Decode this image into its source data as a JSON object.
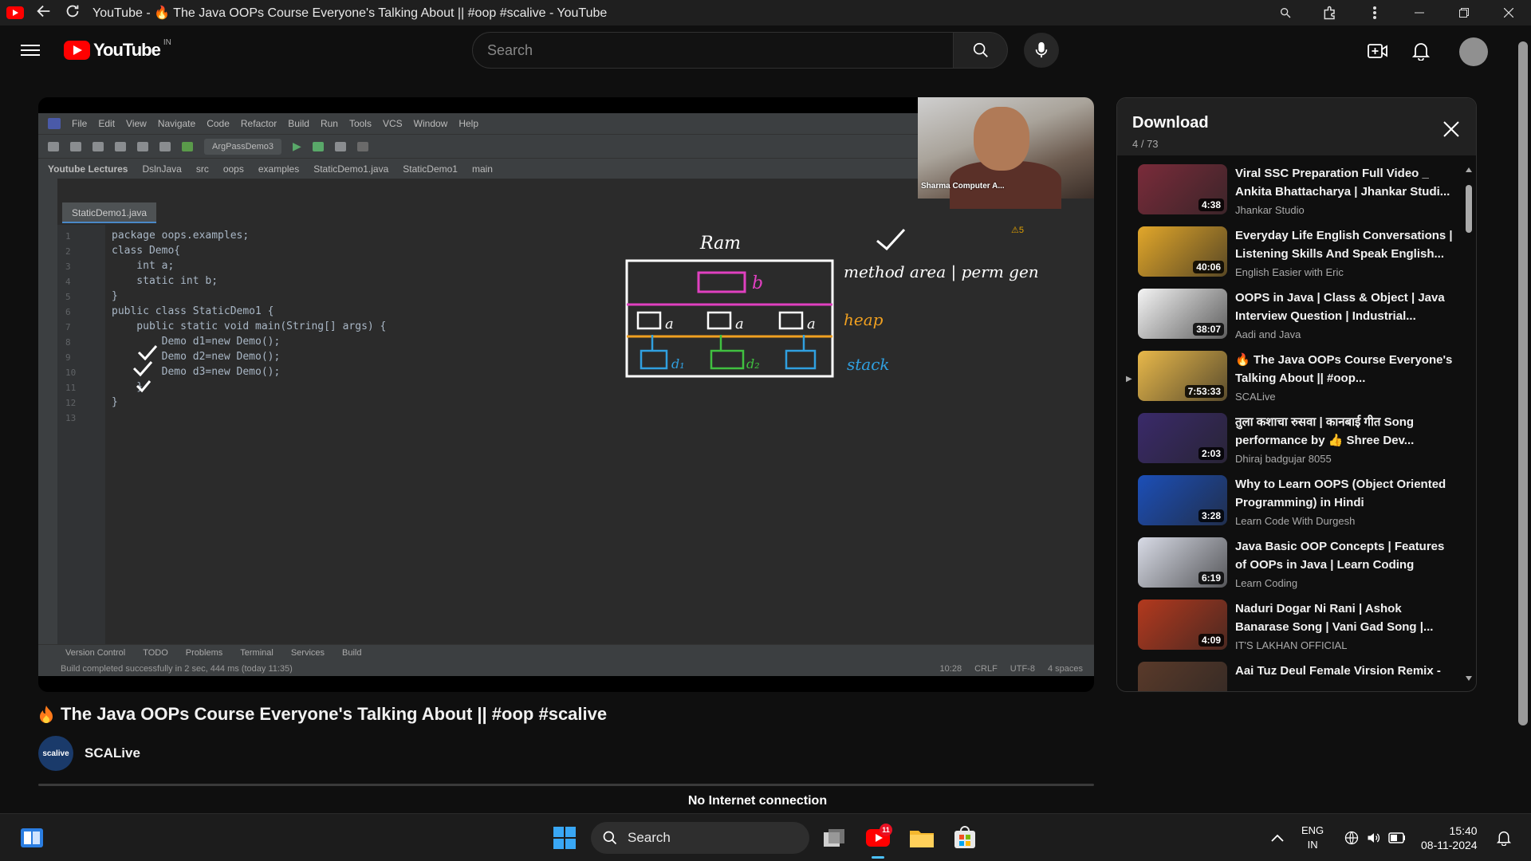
{
  "window": {
    "title": "YouTube - 🔥 The Java OOPs Course Everyone's Talking About || #oop #scalive - YouTube"
  },
  "masthead": {
    "logo_text": "YouTube",
    "region": "IN",
    "search_placeholder": "Search"
  },
  "player": {
    "webcam_label": "Sharma Computer A...",
    "ide": {
      "menu": [
        "File",
        "Edit",
        "View",
        "Navigate",
        "Code",
        "Refactor",
        "Build",
        "Run",
        "Tools",
        "VCS",
        "Window",
        "Help"
      ],
      "run_config": "ArgPassDemo3",
      "breadcrumbs": [
        "Youtube Lectures",
        "DslnJava",
        "src",
        "oops",
        "examples",
        "StaticDemo1.java",
        "StaticDemo1",
        "main"
      ],
      "file_tab": "StaticDemo1.java",
      "code_lines": [
        "package oops.examples;",
        "class Demo{",
        "    int a;",
        "    static int b;",
        "}",
        "public class StaticDemo1 {",
        "    public static void main(String[] args) {",
        "        Demo d1=new Demo();",
        "        Demo d2=new Demo();",
        "        Demo d3=new Demo();",
        "    }",
        "}",
        ""
      ],
      "bottom_tabs": [
        "Version Control",
        "TODO",
        "Problems",
        "Terminal",
        "Services",
        "Build"
      ],
      "status_message": "Build completed successfully in 2 sec, 444 ms (today 11:35)",
      "status_right": [
        "10:28",
        "CRLF",
        "UTF-8",
        "4 spaces"
      ],
      "warnings": "⚠5"
    },
    "drawing": {
      "ram": "Ram",
      "method_area": "method area | perm gen",
      "heap": "heap",
      "stack": "stack"
    }
  },
  "download_panel": {
    "title": "Download",
    "count": "4 / 73",
    "items": [
      {
        "title": "Viral SSC Preparation Full Video _ Ankita Bhattacharya | Jhankar Studi...",
        "channel": "Jhankar Studio",
        "duration": "4:38",
        "thumb_color": "#7a2b3a",
        "current": false
      },
      {
        "title": "Everyday Life English Conversations | Listening Skills And Speak English...",
        "channel": "English Easier with Eric",
        "duration": "40:06",
        "thumb_color": "#e2a72a",
        "current": false
      },
      {
        "title": "OOPS in Java | Class & Object | Java Interview Question | Industrial...",
        "channel": "Aadi and Java",
        "duration": "38:07",
        "thumb_color": "#f4f4f4",
        "current": false
      },
      {
        "title": "🔥 The Java OOPs Course Everyone's Talking About || #oop...",
        "channel": "SCALive",
        "duration": "7:53:33",
        "thumb_color": "#e8b84a",
        "current": true
      },
      {
        "title": "तुला कशाचा रुसवा | कानबाई गीत Song performance by 👍 Shree Dev...",
        "channel": "Dhiraj badgujar 8055",
        "duration": "2:03",
        "thumb_color": "#3a2a6a",
        "current": false
      },
      {
        "title": "Why to Learn OOPS (Object Oriented Programming) in Hindi",
        "channel": "Learn Code With Durgesh",
        "duration": "3:28",
        "thumb_color": "#1c4fb8",
        "current": false
      },
      {
        "title": "Java Basic OOP Concepts | Features of OOPs in Java | Learn Coding",
        "channel": "Learn Coding",
        "duration": "6:19",
        "thumb_color": "#d8dbe6",
        "current": false
      },
      {
        "title": "Naduri Dogar Ni Rani | Ashok Banarase Song | Vani Gad Song |...",
        "channel": "IT'S LAKHAN OFFICIAL",
        "duration": "4:09",
        "thumb_color": "#b3391e",
        "current": false
      },
      {
        "title": "Aai Tuz Deul Female Virsion Remix -",
        "channel": "",
        "duration": "",
        "thumb_color": "#5a3a2a",
        "current": false
      }
    ]
  },
  "video": {
    "title": "The Java OOPs Course Everyone's Talking About || #oop #scalive",
    "channel": "SCALive",
    "channel_avatar_text": "scalive",
    "status": "No Internet connection"
  },
  "taskbar": {
    "search_label": "Search",
    "youtube_badge": "11",
    "lang": "ENG",
    "region": "IN",
    "time": "15:40",
    "date": "08-11-2024"
  },
  "colors": {
    "youtube_red": "#ff0000",
    "background": "#0f0f0f",
    "panel_header": "#212121"
  }
}
